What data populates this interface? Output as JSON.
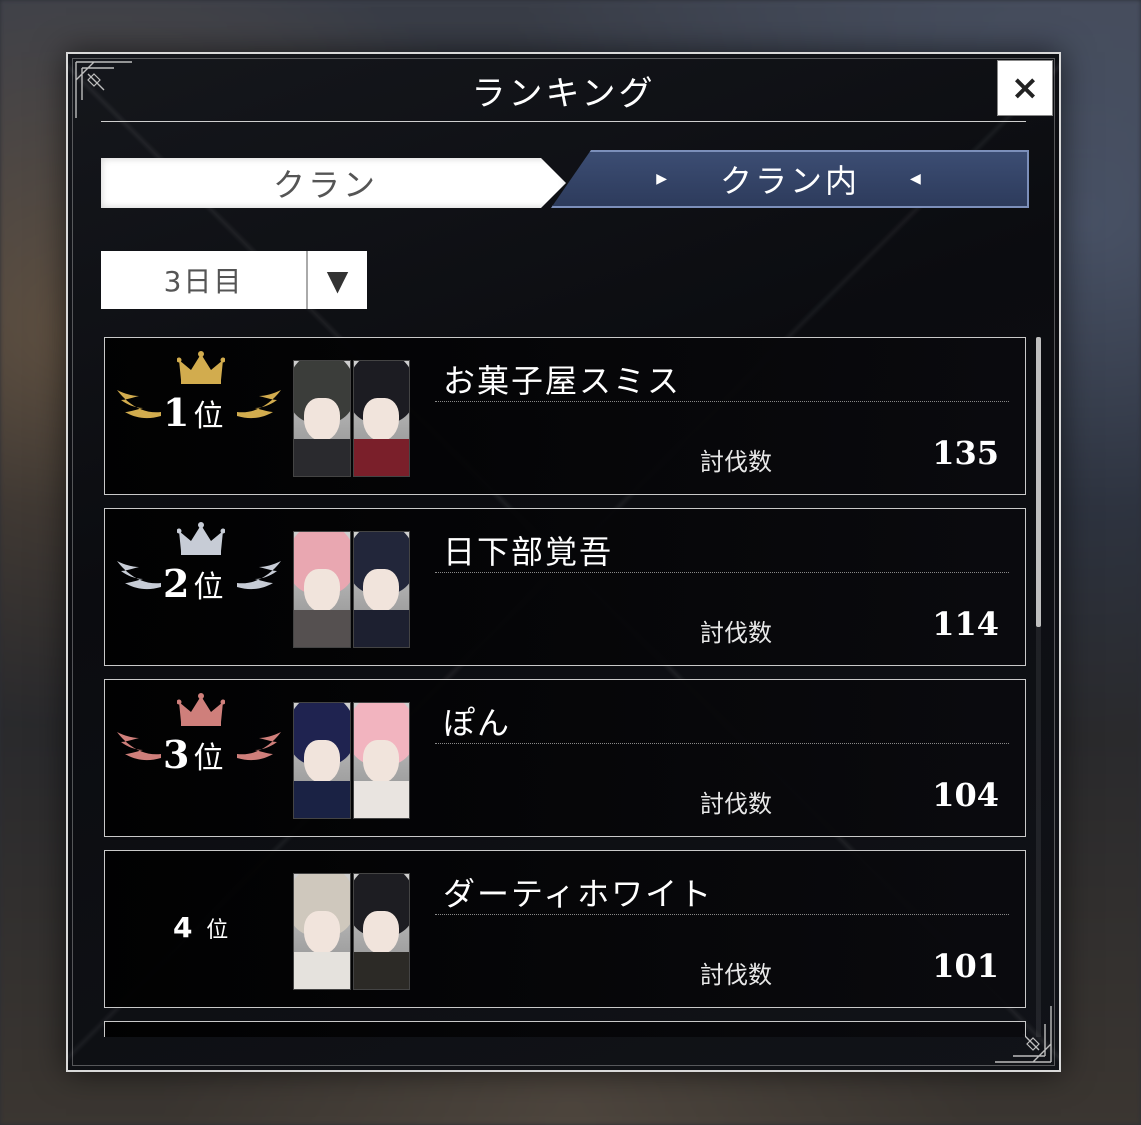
{
  "dialog": {
    "title": "ランキング",
    "close_label": "×"
  },
  "tabs": [
    {
      "label": "クラン",
      "active": false
    },
    {
      "label": "クラン内",
      "active": true
    }
  ],
  "day_select": {
    "selected": "3日目",
    "caret": "▼"
  },
  "colors": {
    "gold": "#d2ac4e",
    "silver": "#c7ccd6",
    "bronze": "#cf7f7b",
    "tab_active": "#34446a"
  },
  "kill_label": "討伐数",
  "ranking": [
    {
      "rank": "1",
      "rank_suffix": "位",
      "medal": "gold",
      "name": "お菓子屋スミス",
      "kills": "135",
      "portraits": [
        {
          "hair": "#3b3d3a",
          "body": "#2a2a2e"
        },
        {
          "hair": "#1c1c22",
          "body": "#7a1f2a"
        }
      ]
    },
    {
      "rank": "2",
      "rank_suffix": "位",
      "medal": "silver",
      "name": "日下部覚吾",
      "kills": "114",
      "portraits": [
        {
          "hair": "#e9a7b1",
          "body": "#555050"
        },
        {
          "hair": "#22263a",
          "body": "#1d2030"
        }
      ]
    },
    {
      "rank": "3",
      "rank_suffix": "位",
      "medal": "bronze",
      "name": "ぽん",
      "kills": "104",
      "portraits": [
        {
          "hair": "#1f2350",
          "body": "#1a2244"
        },
        {
          "hair": "#f2b4bf",
          "body": "#e9e4e0"
        }
      ]
    },
    {
      "rank": "4",
      "rank_suffix": "位",
      "medal": "none",
      "name": "ダーティホワイト",
      "kills": "101",
      "portraits": [
        {
          "hair": "#cfc8bd",
          "body": "#e5e2dd"
        },
        {
          "hair": "#1d1d22",
          "body": "#2c2a26"
        }
      ]
    }
  ]
}
